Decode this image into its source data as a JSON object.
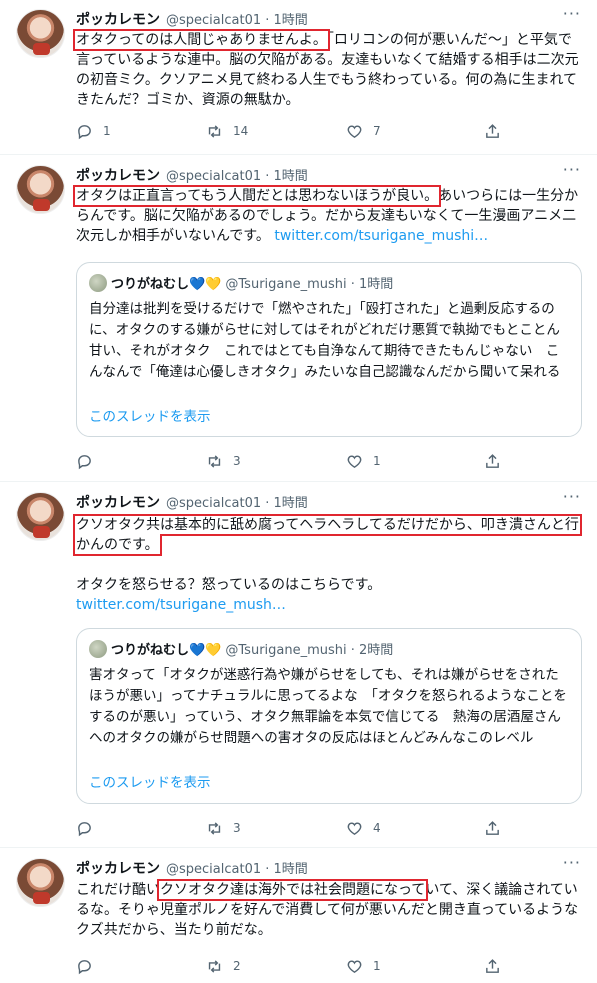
{
  "tweets": [
    {
      "name": "ポッカレモン",
      "handle": "@specialcat01 · 1時間",
      "more": "···",
      "text_hl": "オタクってのは人間じゃありませんよ。",
      "text_rest": "「ロリコンの何が悪いんだ〜」と平気で言っているような連中。脳の欠陥がある。友達もいなくて結婚する相手は二次元の初音ミク。クソアニメ見て終わる人生でもう終わっている。何の為に生まれてきたんだ？ゴミか、資源の無駄か。",
      "reply": "1",
      "retweet": "14",
      "like": "7"
    },
    {
      "name": "ポッカレモン",
      "handle": "@specialcat01 · 1時間",
      "more": "···",
      "text_hl": "オタクは正直言ってもう人間だとは思わないほうが良い。",
      "text_rest": "あいつらには一生分からんです。脳に欠陥があるのでしょう。だから友達もいなくて一生漫画アニメ二次元しか相手がいないんです。",
      "link": "twitter.com/tsurigane_mushi…",
      "quote": {
        "name": "つりがねむし",
        "heart_blue": "💙",
        "heart_yellow": "💛",
        "handle": "@Tsurigane_mushi · 1時間",
        "text": "自分達は批判を受けるだけで「燃やされた」「殴打された」と過剰反応するのに、オタクのする嫌がらせに対してはそれがどれだけ悪質で執拗でもとことん甘い、それがオタク　これではとても自浄なんて期待できたもんじゃない　こんなんで「俺達は心優しきオタク」みたいな自己認識なんだから聞いて呆れる",
        "thread": "このスレッドを表示"
      },
      "reply": "",
      "retweet": "3",
      "like": "1"
    },
    {
      "name": "ポッカレモン",
      "handle": "@specialcat01 · 1時間",
      "more": "···",
      "text_hl": "クソオタク共は基本的に舐め腐ってヘラヘラしてるだけだから、叩き潰さんと行かんのです。",
      "text_rest2": "オタクを怒らせる？怒っているのはこちらです。",
      "link": "twitter.com/tsurigane_mush…",
      "quote": {
        "name": "つりがねむし",
        "heart_blue": "💙",
        "heart_yellow": "💛",
        "handle": "@Tsurigane_mushi · 2時間",
        "text": "害オタって「オタクが迷惑行為や嫌がらせをしても、それは嫌がらせをされたほうが悪い」ってナチュラルに思ってるよな　「オタクを怒られるようなことをするのが悪い」っていう、オタク無罪論を本気で信じてる　熱海の居酒屋さんへのオタクの嫌がらせ問題への害オタの反応はほとんどみんなこのレベル",
        "thread": "このスレッドを表示"
      },
      "reply": "",
      "retweet": "3",
      "like": "4"
    },
    {
      "name": "ポッカレモン",
      "handle": "@specialcat01 · 1時間",
      "more": "···",
      "text_pre": "これだけ酷い",
      "text_hl": "クソオタク達は海外では社会問題になって",
      "text_rest": "いて、深く議論されているな。そりゃ児童ポルノを好んで消費して何が悪いんだと開き直っているようなクズ共だから、当たり前だな。",
      "reply": "",
      "retweet": "2",
      "like": "1"
    }
  ]
}
